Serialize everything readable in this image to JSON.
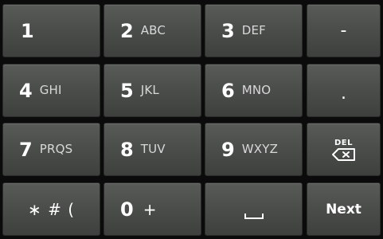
{
  "keys": {
    "k1": {
      "digit": "1",
      "letters": ""
    },
    "k2": {
      "digit": "2",
      "letters": "ABC"
    },
    "k3": {
      "digit": "3",
      "letters": "DEF"
    },
    "k4": {
      "digit": "4",
      "letters": "GHI"
    },
    "k5": {
      "digit": "5",
      "letters": "JKL"
    },
    "k6": {
      "digit": "6",
      "letters": "MNO"
    },
    "k7": {
      "digit": "7",
      "letters": "PRQS"
    },
    "k8": {
      "digit": "8",
      "letters": "TUV"
    },
    "k9": {
      "digit": "9",
      "letters": "WXYZ"
    },
    "k0": {
      "digit": "0",
      "letters": "+"
    },
    "dash": "-",
    "period": ".",
    "symbols": "∗ # (",
    "del_label": "DEL",
    "next_label": "Next"
  },
  "colors": {
    "background": "#0b0b0b",
    "key_top": "#585b58",
    "key_bottom": "#3e403e",
    "text": "#ffffff"
  }
}
